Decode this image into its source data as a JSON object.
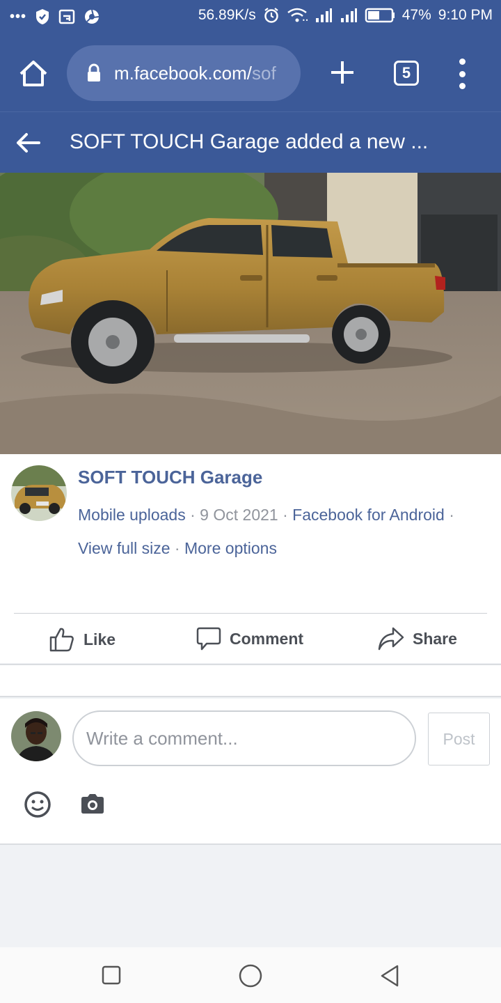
{
  "status_bar": {
    "notifications_glyph": "•••",
    "speed": "56.89K/s",
    "battery": "47%",
    "time": "9:10 PM",
    "icons": [
      "shield-icon",
      "cast-icon",
      "browser-icon",
      "alarm-icon",
      "wifi-icon",
      "signal-icon",
      "signal-icon",
      "battery-icon"
    ]
  },
  "browser": {
    "url_main": "m.facebook.com/",
    "url_faded": "sof",
    "tab_count": "5"
  },
  "page_header": {
    "title": "SOFT TOUCH Garage added a new ..."
  },
  "post": {
    "page_name": "SOFT TOUCH Garage",
    "source": "Mobile uploads",
    "sep": "·",
    "date": "9 Oct 2021",
    "app": "Facebook for Android",
    "view_full_size": "View full size",
    "more_options": "More options"
  },
  "actions": {
    "like": "Like",
    "comment": "Comment",
    "share": "Share"
  },
  "composer": {
    "placeholder": "Write a comment...",
    "post_label": "Post"
  },
  "colors": {
    "facebook_blue": "#3b5998",
    "link_blue": "#4b6499",
    "truck_gold": "#b08a3e"
  }
}
